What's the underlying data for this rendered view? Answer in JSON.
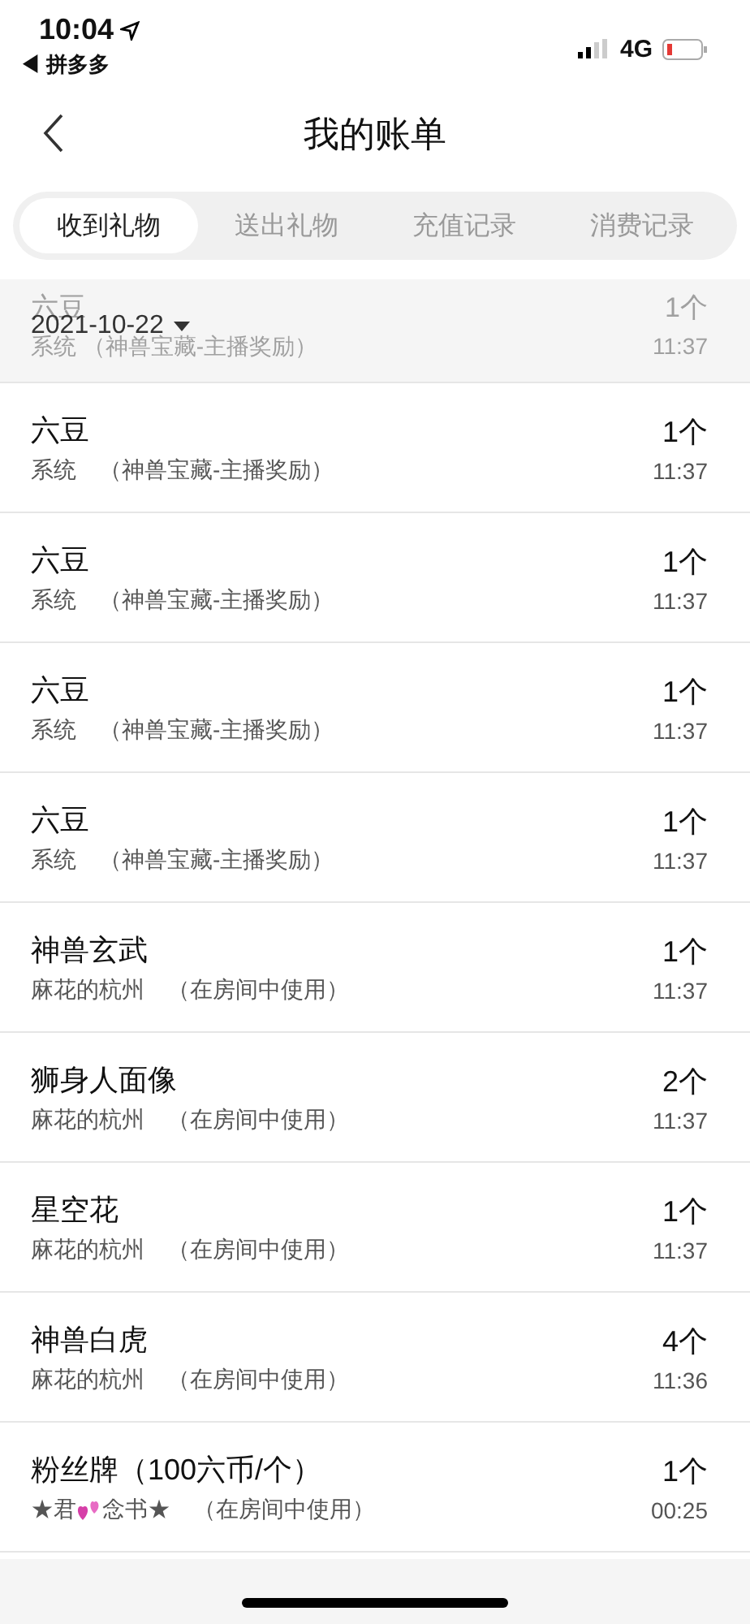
{
  "status_bar": {
    "time": "10:04",
    "back_app": "◀ 拼多多",
    "network": "4G"
  },
  "nav": {
    "title": "我的账单"
  },
  "tabs": [
    {
      "label": "收到礼物",
      "selected": true
    },
    {
      "label": "送出礼物",
      "selected": false
    },
    {
      "label": "充值记录",
      "selected": false
    },
    {
      "label": "消费记录",
      "selected": false
    }
  ],
  "date_header": {
    "date": "2021-10-22"
  },
  "faded_row": {
    "name": "六豆",
    "detail": "系统  （神兽宝藏-主播奖励）",
    "count": "1个",
    "time": "11:37"
  },
  "rows": [
    {
      "name": "六豆",
      "sender": [
        {
          "kind": "text",
          "text": "系统"
        }
      ],
      "note": "（神兽宝藏-主播奖励）",
      "count": "1个",
      "time": "11:37"
    },
    {
      "name": "六豆",
      "sender": [
        {
          "kind": "text",
          "text": "系统"
        }
      ],
      "note": "（神兽宝藏-主播奖励）",
      "count": "1个",
      "time": "11:37"
    },
    {
      "name": "六豆",
      "sender": [
        {
          "kind": "text",
          "text": "系统"
        }
      ],
      "note": "（神兽宝藏-主播奖励）",
      "count": "1个",
      "time": "11:37"
    },
    {
      "name": "六豆",
      "sender": [
        {
          "kind": "text",
          "text": "系统"
        }
      ],
      "note": "（神兽宝藏-主播奖励）",
      "count": "1个",
      "time": "11:37"
    },
    {
      "name": "神兽玄武",
      "sender": [
        {
          "kind": "text",
          "text": "麻花的杭州"
        }
      ],
      "note": "（在房间中使用）",
      "count": "1个",
      "time": "11:37"
    },
    {
      "name": "狮身人面像",
      "sender": [
        {
          "kind": "text",
          "text": "麻花的杭州"
        }
      ],
      "note": "（在房间中使用）",
      "count": "2个",
      "time": "11:37"
    },
    {
      "name": "星空花",
      "sender": [
        {
          "kind": "text",
          "text": "麻花的杭州"
        }
      ],
      "note": "（在房间中使用）",
      "count": "1个",
      "time": "11:37"
    },
    {
      "name": "神兽白虎",
      "sender": [
        {
          "kind": "text",
          "text": "麻花的杭州"
        }
      ],
      "note": "（在房间中使用）",
      "count": "4个",
      "time": "11:36"
    },
    {
      "name": "粉丝牌（100六币/个）",
      "sender": [
        {
          "kind": "text",
          "text": "★君"
        },
        {
          "kind": "hearts"
        },
        {
          "kind": "text",
          "text": "念书★"
        }
      ],
      "note": "（在房间中使用）",
      "count": "1个",
      "time": "00:25"
    }
  ]
}
